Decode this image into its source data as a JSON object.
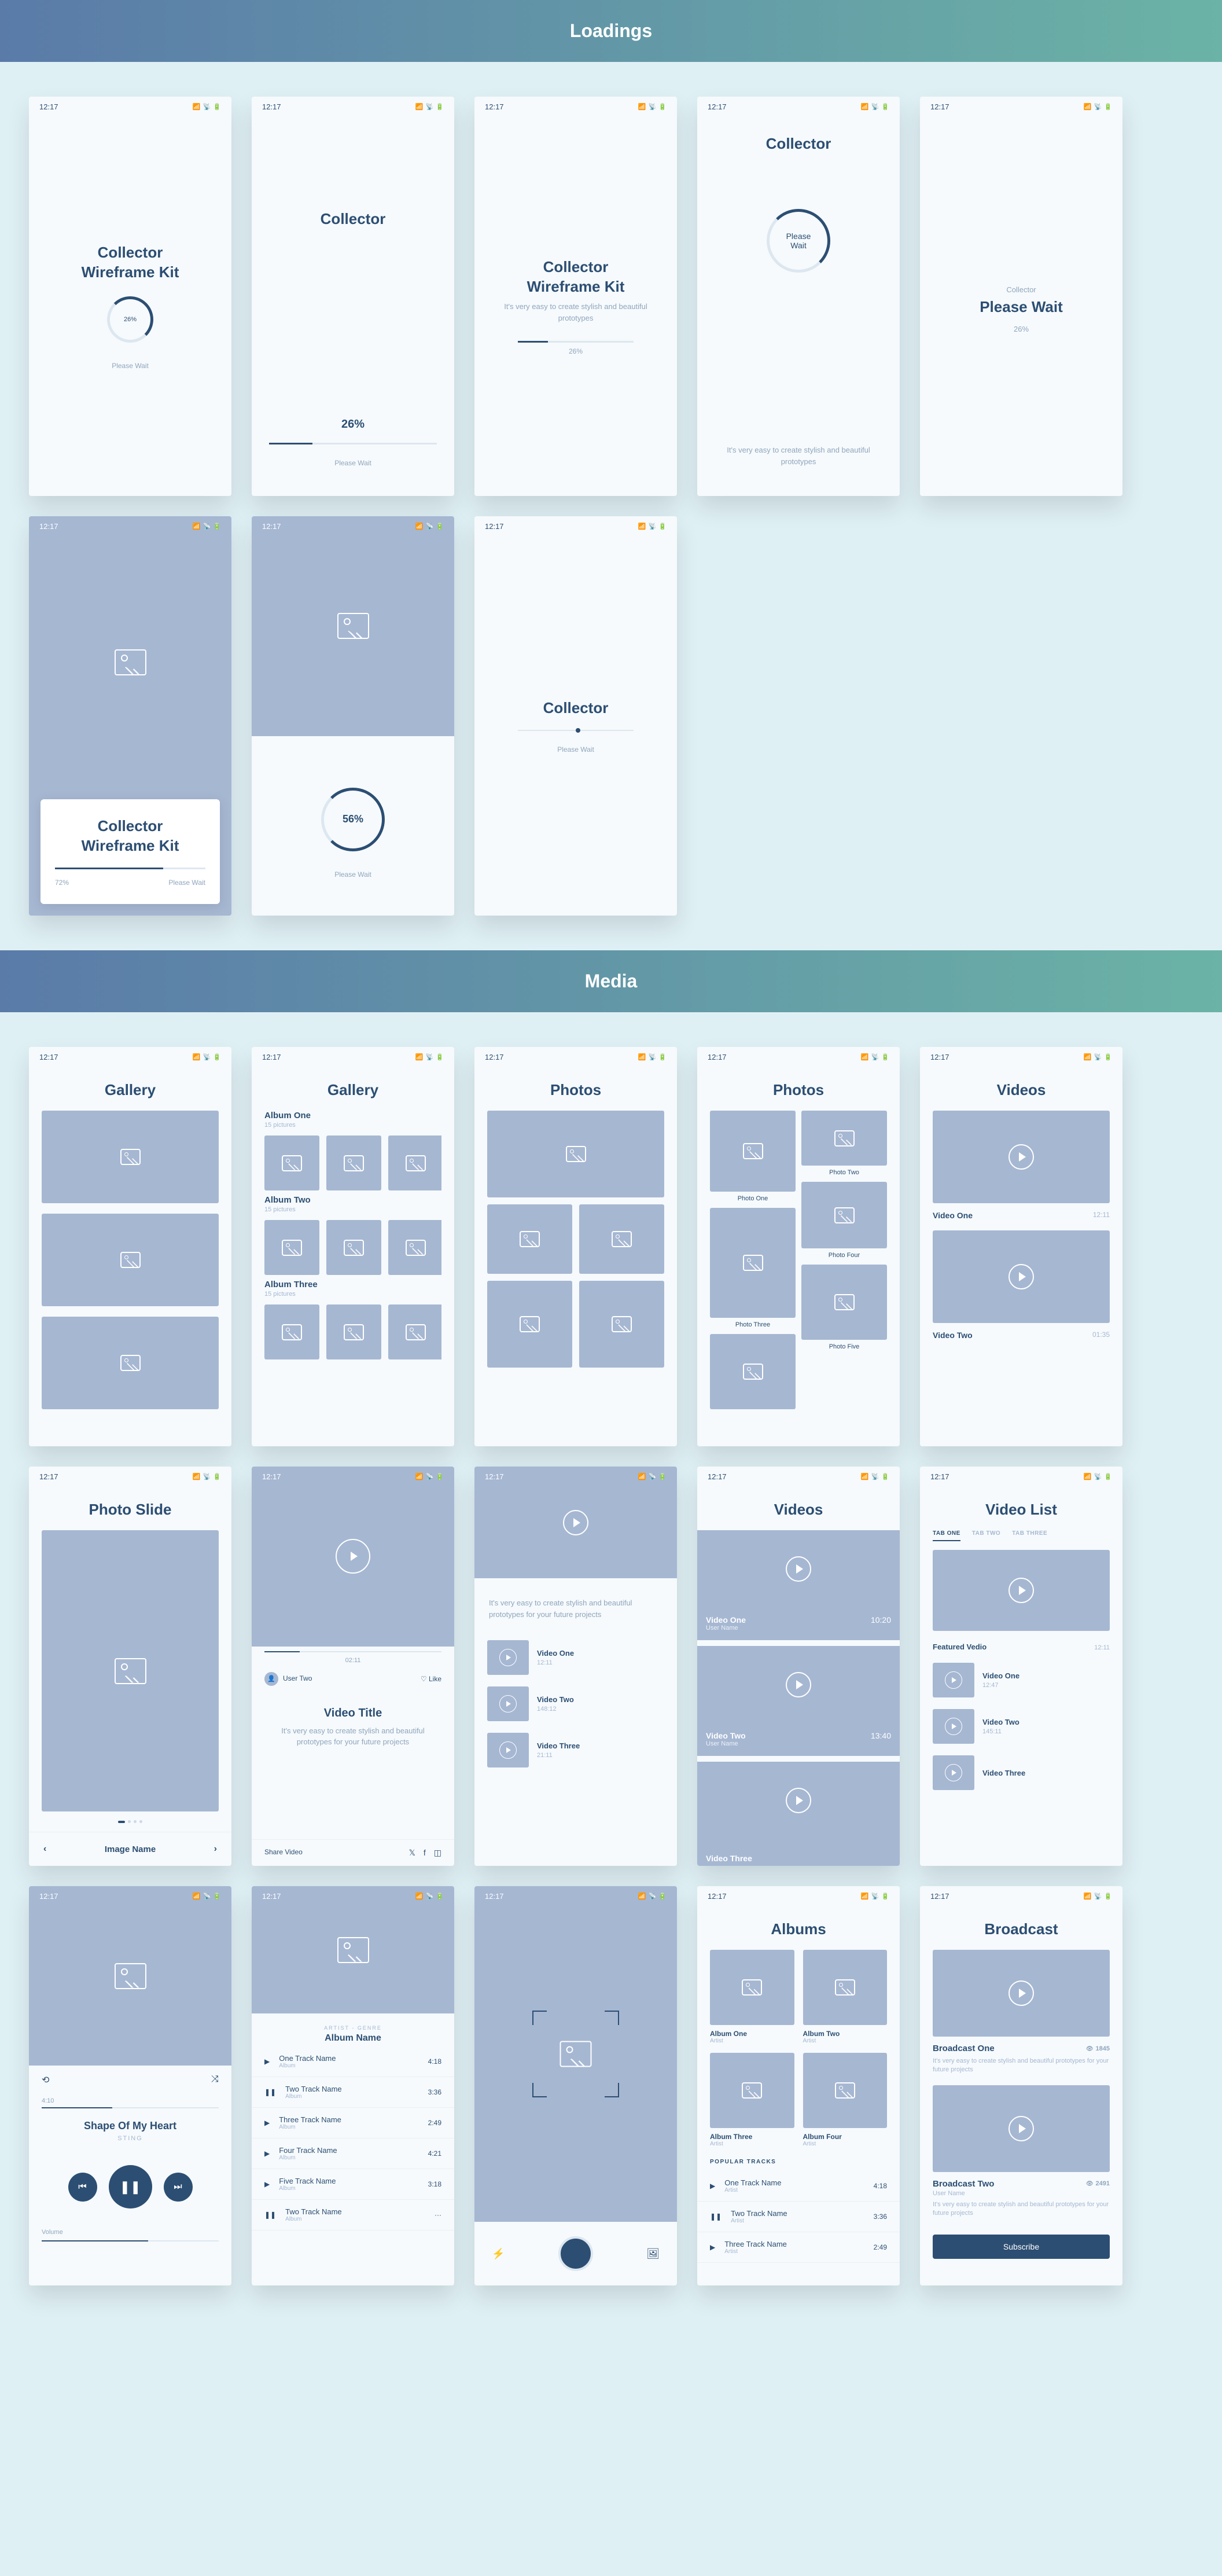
{
  "sections": {
    "loadings": "Loadings",
    "media": "Media"
  },
  "status": {
    "time": "12:17",
    "signal": "▪▪▪",
    "wifi": "◉",
    "battery": "▬"
  },
  "loading": {
    "s1": {
      "title": "Collector\nWireframe Kit",
      "pct": "26%",
      "wait": "Please Wait"
    },
    "s2": {
      "title": "Collector",
      "pct": "26%",
      "wait": "Please Wait"
    },
    "s3": {
      "title": "Collector\nWireframe Kit",
      "sub": "It's very easy to create stylish and beautiful prototypes",
      "pct": "26%"
    },
    "s4": {
      "title": "Collector",
      "spinner": "Please\nWait",
      "sub": "It's very easy to create stylish and beautiful prototypes"
    },
    "s5": {
      "brand": "Collector",
      "wait": "Please Wait",
      "pct": "26%"
    },
    "s6": {
      "title": "Collector\nWireframe Kit",
      "pct": "72%",
      "wait": "Please Wait"
    },
    "s7": {
      "pct": "56%",
      "wait": "Please Wait"
    },
    "s8": {
      "title": "Collector",
      "wait": "Please Wait"
    }
  },
  "media": {
    "gallery": "Gallery",
    "albums_header": "Albums",
    "photos": "Photos",
    "videos": "Videos",
    "videolist": "Video List",
    "photoslide": "Photo Slide",
    "broadcast": "Broadcast",
    "albums": [
      {
        "title": "Album One",
        "sub": "15 pictures"
      },
      {
        "title": "Album Two",
        "sub": "15 pictures"
      },
      {
        "title": "Album Three",
        "sub": "15 pictures"
      }
    ],
    "photo_caps": [
      "Photo One",
      "Photo Two",
      "Photo Three",
      "Photo Four",
      "Photo Five"
    ],
    "vids": [
      {
        "title": "Video One",
        "time": "12:11"
      },
      {
        "title": "Video Two",
        "time": "01:35"
      }
    ],
    "imagename": "Image Name",
    "usertwo": "User Two",
    "like": "Like",
    "videotitle": "Video Title",
    "videodesc": "It's very easy to create stylish and beautiful prototypes for your future projects",
    "sharevideo": "Share Video",
    "scrub": "02:11",
    "vlist": [
      {
        "title": "Video One",
        "sub": "12:11"
      },
      {
        "title": "Video Two",
        "sub": "148:12"
      },
      {
        "title": "Video Three",
        "sub": "21:11"
      }
    ],
    "vsc": [
      {
        "title": "Video One",
        "user": "User Name",
        "time": "10:20"
      },
      {
        "title": "Video Two",
        "user": "User Name",
        "time": "13:40"
      },
      {
        "title": "Video Three",
        "user": "",
        "time": ""
      }
    ],
    "tabs": [
      "TAB ONE",
      "TAB TWO",
      "TAB THREE"
    ],
    "featured": {
      "title": "Featured Vedio",
      "time": "12:11"
    },
    "vlist2": [
      {
        "title": "Video One",
        "sub": "12:47"
      },
      {
        "title": "Video Two",
        "sub": "145:11"
      },
      {
        "title": "Video Three",
        "sub": ""
      }
    ],
    "player": {
      "t1": "4:10",
      "t2": "",
      "title": "Shape Of My Heart",
      "artist": "STING",
      "vol": "Volume"
    },
    "tracklist": {
      "artist": "ARTIST - GENRE",
      "album": "Album Name",
      "tracks": [
        {
          "n": "One Track Name",
          "a": "Album",
          "d": "4:18",
          "p": "▶"
        },
        {
          "n": "Two Track Name",
          "a": "Album",
          "d": "3:36",
          "p": "❚❚"
        },
        {
          "n": "Three Track Name",
          "a": "Album",
          "d": "2:49",
          "p": "▶"
        },
        {
          "n": "Four Track Name",
          "a": "Album",
          "d": "4:21",
          "p": "▶"
        },
        {
          "n": "Five Track Name",
          "a": "Album",
          "d": "3:18",
          "p": "▶"
        },
        {
          "n": "Two Track Name",
          "a": "Album",
          "d": "···",
          "p": "❚❚"
        }
      ]
    },
    "albumgrid": [
      {
        "n": "Album One",
        "a": "Artist"
      },
      {
        "n": "Album Two",
        "a": "Artist"
      },
      {
        "n": "Album Three",
        "a": "Artist"
      },
      {
        "n": "Album Four",
        "a": "Artist"
      }
    ],
    "popular": "POPULAR TRACKS",
    "poptracks": [
      {
        "n": "One Track Name",
        "a": "Artist",
        "d": "4:18",
        "p": "▶"
      },
      {
        "n": "Two Track Name",
        "a": "Artist",
        "d": "3:36",
        "p": "❚❚"
      },
      {
        "n": "Three Track Name",
        "a": "Artist",
        "d": "2:49",
        "p": "▶"
      }
    ],
    "broadcasts": [
      {
        "t": "Broadcast One",
        "v": "1845",
        "d": "It's very easy to create stylish and beautiful prototypes for your future projects"
      },
      {
        "t": "Broadcast Two",
        "v": "2491",
        "u": "User Name",
        "d": "It's very easy to create stylish and beautiful prototypes for your future projects"
      }
    ],
    "subscribe": "Subscribe"
  }
}
